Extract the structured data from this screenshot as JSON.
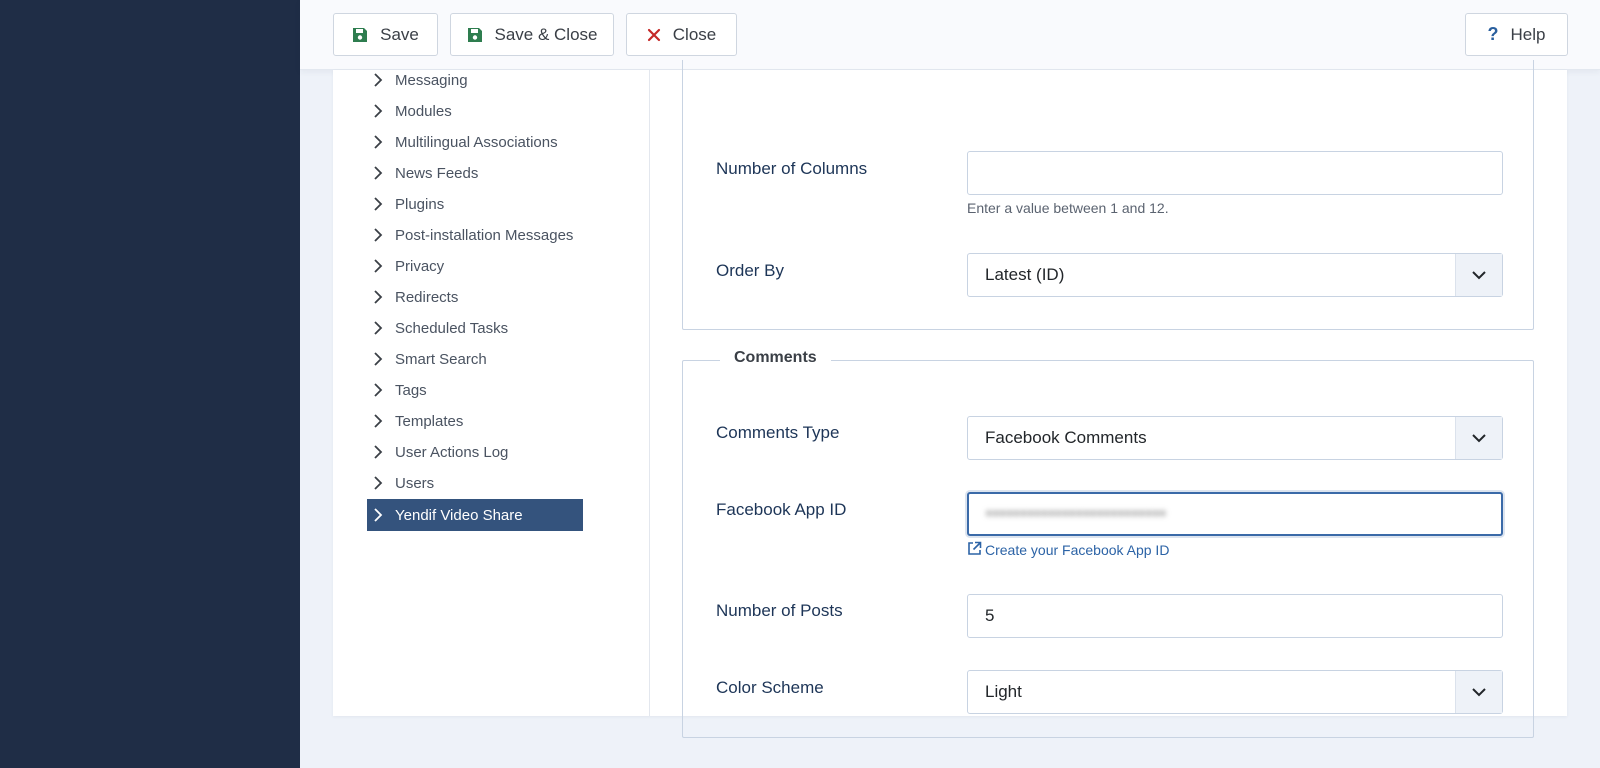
{
  "toolbar": {
    "save_label": "Save",
    "save_close_label": "Save & Close",
    "close_label": "Close",
    "help_label": "Help",
    "help_symbol": "?"
  },
  "sidebar": {
    "items": [
      {
        "label": "Messaging"
      },
      {
        "label": "Modules"
      },
      {
        "label": "Multilingual Associations"
      },
      {
        "label": "News Feeds"
      },
      {
        "label": "Plugins"
      },
      {
        "label": "Post-installation Messages"
      },
      {
        "label": "Privacy"
      },
      {
        "label": "Redirects"
      },
      {
        "label": "Scheduled Tasks"
      },
      {
        "label": "Smart Search"
      },
      {
        "label": "Tags"
      },
      {
        "label": "Templates"
      },
      {
        "label": "User Actions Log"
      },
      {
        "label": "Users"
      },
      {
        "label": "Yendif Video Share",
        "active": true
      }
    ]
  },
  "form": {
    "columns": {
      "label": "Number of Columns",
      "value": "",
      "hint": "Enter a value between 1 and 12."
    },
    "order_by": {
      "label": "Order By",
      "value": "Latest (ID)"
    },
    "comments": {
      "legend": "Comments",
      "type": {
        "label": "Comments Type",
        "value": "Facebook Comments"
      },
      "app_id": {
        "label": "Facebook App ID",
        "value": "••••••••••••••••••••••••••",
        "link": "Create your Facebook App ID"
      },
      "posts": {
        "label": "Number of Posts",
        "value": "5"
      },
      "color_scheme": {
        "label": "Color Scheme",
        "value": "Light"
      }
    }
  }
}
